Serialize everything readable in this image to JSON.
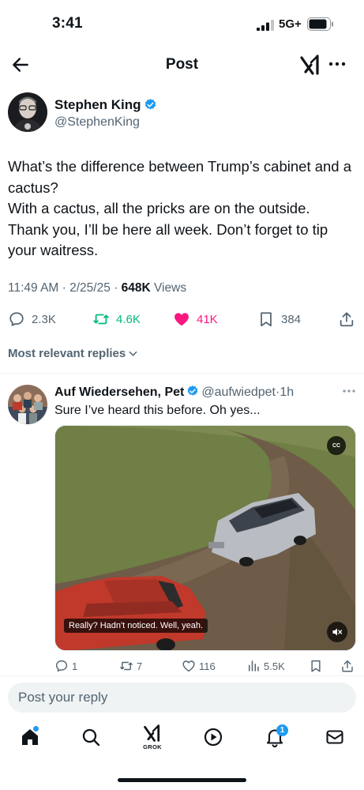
{
  "status_bar": {
    "time": "3:41",
    "network": "5G+"
  },
  "nav": {
    "title": "Post"
  },
  "post": {
    "author_name": "Stephen King",
    "author_handle": "@StephenKing",
    "text": "What’s the difference between Trump’s cabinet and a cactus?\nWith a cactus, all the pricks are on the outside.\nThank you, I’ll be here all week. Don’t forget to tip your waitress.",
    "time": "11:49 AM",
    "date": "2/25/25",
    "views_count": "648K",
    "views_label": "Views",
    "replies": "2.3K",
    "reposts": "4.6K",
    "likes": "41K",
    "bookmarks": "384"
  },
  "replies_sort": {
    "label": "Most relevant replies"
  },
  "reply": {
    "name": "Auf Wiedersehen, Pet",
    "handle": "@aufwiedpet",
    "age": "1h",
    "text": "Sure I’ve heard this before. Oh yes...",
    "video": {
      "cc_label": "CC",
      "subtitle": "Really? Hadn't noticed. Well, yeah."
    },
    "replies": "1",
    "reposts": "7",
    "likes": "116",
    "views": "5.5K"
  },
  "composer": {
    "placeholder": "Post your reply"
  },
  "tab_bar": {
    "grok_label": "GROK",
    "notification_count": "1"
  },
  "colors": {
    "accent": "#1d9bf0",
    "repost": "#00ba7c",
    "like": "#f91880",
    "muted": "#536471"
  },
  "icons": [
    "back-arrow-icon",
    "grok-icon",
    "more-icon",
    "verified-badge-icon",
    "reply-icon",
    "repost-icon",
    "heart-icon",
    "bookmark-icon",
    "share-icon",
    "chevron-down-icon",
    "views-icon",
    "home-icon",
    "search-icon",
    "play-icon",
    "bell-icon",
    "mail-icon",
    "mute-icon"
  ]
}
